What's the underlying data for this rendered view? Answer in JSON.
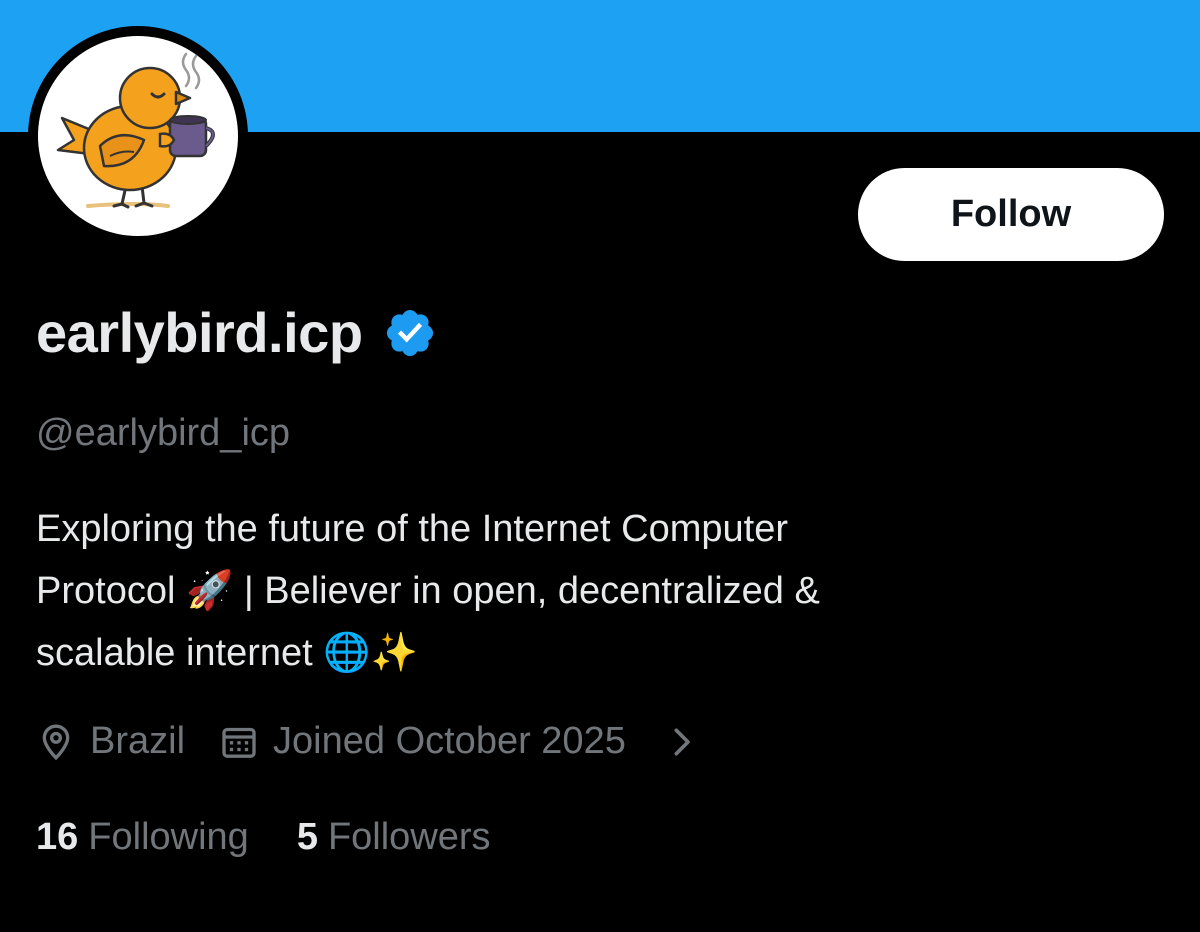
{
  "profile": {
    "display_name": "earlybird.icp",
    "handle": "@earlybird_icp",
    "verified": true,
    "bio_lines": [
      "Exploring the future of the Internet Computer",
      "Protocol 🚀 | Believer in open, decentralized &",
      "scalable internet 🌐✨"
    ],
    "location": "Brazil",
    "joined": "Joined October 2025",
    "following_count": "16",
    "following_label": "Following",
    "followers_count": "5",
    "followers_label": "Followers"
  },
  "actions": {
    "follow_label": "Follow"
  },
  "icons": {
    "location": "location-pin-icon",
    "calendar": "calendar-icon",
    "chevron": "chevron-right-icon",
    "verified": "verified-badge-icon"
  },
  "colors": {
    "banner": "#1DA1F2",
    "background": "#000000",
    "primary_text": "#e7e9ea",
    "secondary_text": "#71767b",
    "verified": "#1D9BF0",
    "bird": "#F4A11E",
    "mug": "#6B5B8C"
  }
}
